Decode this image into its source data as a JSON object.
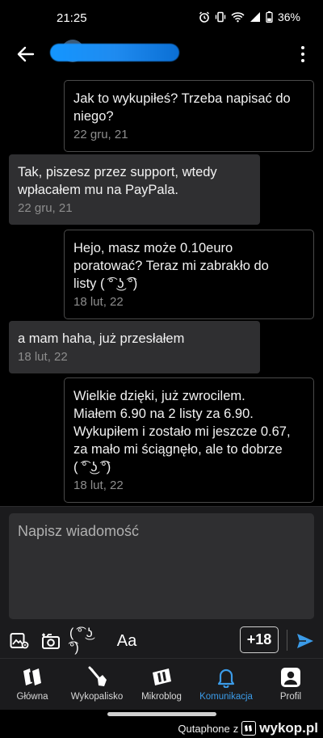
{
  "status_bar": {
    "time": "21:25",
    "battery": "36%"
  },
  "header": {
    "back_icon": "arrow-left-icon",
    "menu_icon": "kebab-menu-icon"
  },
  "messages": [
    {
      "direction": "out",
      "lines": [
        "Jak to wykupiłeś? Trzeba napisać do",
        "niego?"
      ],
      "date": "22 gru, 21"
    },
    {
      "direction": "in",
      "lines": [
        "Tak, piszesz przez support, wtedy",
        "wpłacałem mu na PayPala."
      ],
      "date": "22 gru, 21"
    },
    {
      "direction": "out",
      "lines": [
        "Hejo, masz może 0.10euro",
        "poratować? Teraz mi zabrakło do",
        "listy ( ͡° ͜ʖ ͡°)"
      ],
      "date": "18 lut, 22"
    },
    {
      "direction": "in",
      "lines": [
        "a mam haha, już przesłałem"
      ],
      "date": "18 lut, 22"
    },
    {
      "direction": "out",
      "lines": [
        "Wielkie dzięki, już zwrocilem.",
        "Miałem 6.90 na 2 listy za 6.90.",
        "Wykupiłem i zostało mi jeszcze 0.67,",
        "za mało mi ściągnęło, ale to dobrze",
        "( ͡° ͜ʖ ͡°)"
      ],
      "date": "18 lut, 22"
    }
  ],
  "composer": {
    "placeholder": "Napisz wiadomość",
    "lenny_label": "( ͡° ͜ʖ ͡°)",
    "format_label": "Aa",
    "counter_label": "+18"
  },
  "bottom_nav": [
    {
      "label": "Główna",
      "icon": "wykop-logo-icon",
      "active": false
    },
    {
      "label": "Wykopalisko",
      "icon": "shovel-icon",
      "active": false
    },
    {
      "label": "Mikroblog",
      "icon": "mikroblog-icon",
      "active": false
    },
    {
      "label": "Komunikacja",
      "icon": "bell-icon",
      "active": true
    },
    {
      "label": "Profil",
      "icon": "profile-icon",
      "active": false
    }
  ],
  "watermark": {
    "author": "Qutaphone",
    "joiner": "z",
    "site": "wykop.pl"
  },
  "colors": {
    "accent": "#3b9be8",
    "incoming_bubble": "#2f2f31",
    "panel": "#1b1b1d",
    "send": "#3b9be8"
  }
}
